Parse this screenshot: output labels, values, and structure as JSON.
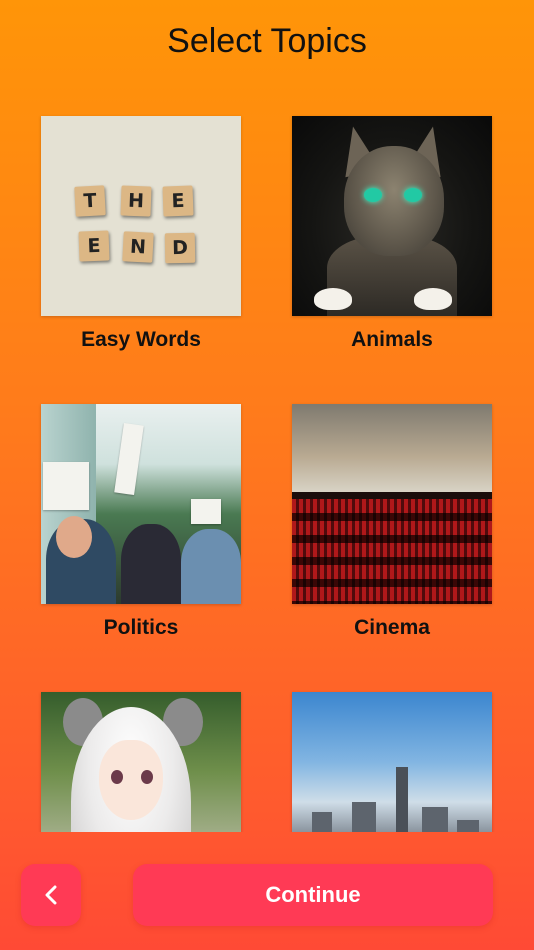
{
  "header": {
    "title": "Select Topics"
  },
  "topics": [
    {
      "label": "Easy Words",
      "image": "scrabble-tiles-the-end"
    },
    {
      "label": "Animals",
      "image": "cat-portrait"
    },
    {
      "label": "Politics",
      "image": "protest-crowd"
    },
    {
      "label": "Cinema",
      "image": "movie-theater-seats"
    },
    {
      "label": "",
      "image": "anime-cosplay-mask"
    },
    {
      "label": "",
      "image": "city-skyline"
    }
  ],
  "tiles": [
    "T",
    "H",
    "E",
    "E",
    "N",
    "D"
  ],
  "footer": {
    "back_icon": "chevron-left-icon",
    "continue_label": "Continue"
  },
  "colors": {
    "gradient_top": "#ff9508",
    "gradient_bottom": "#ff4a35",
    "button": "#ff3a55"
  }
}
